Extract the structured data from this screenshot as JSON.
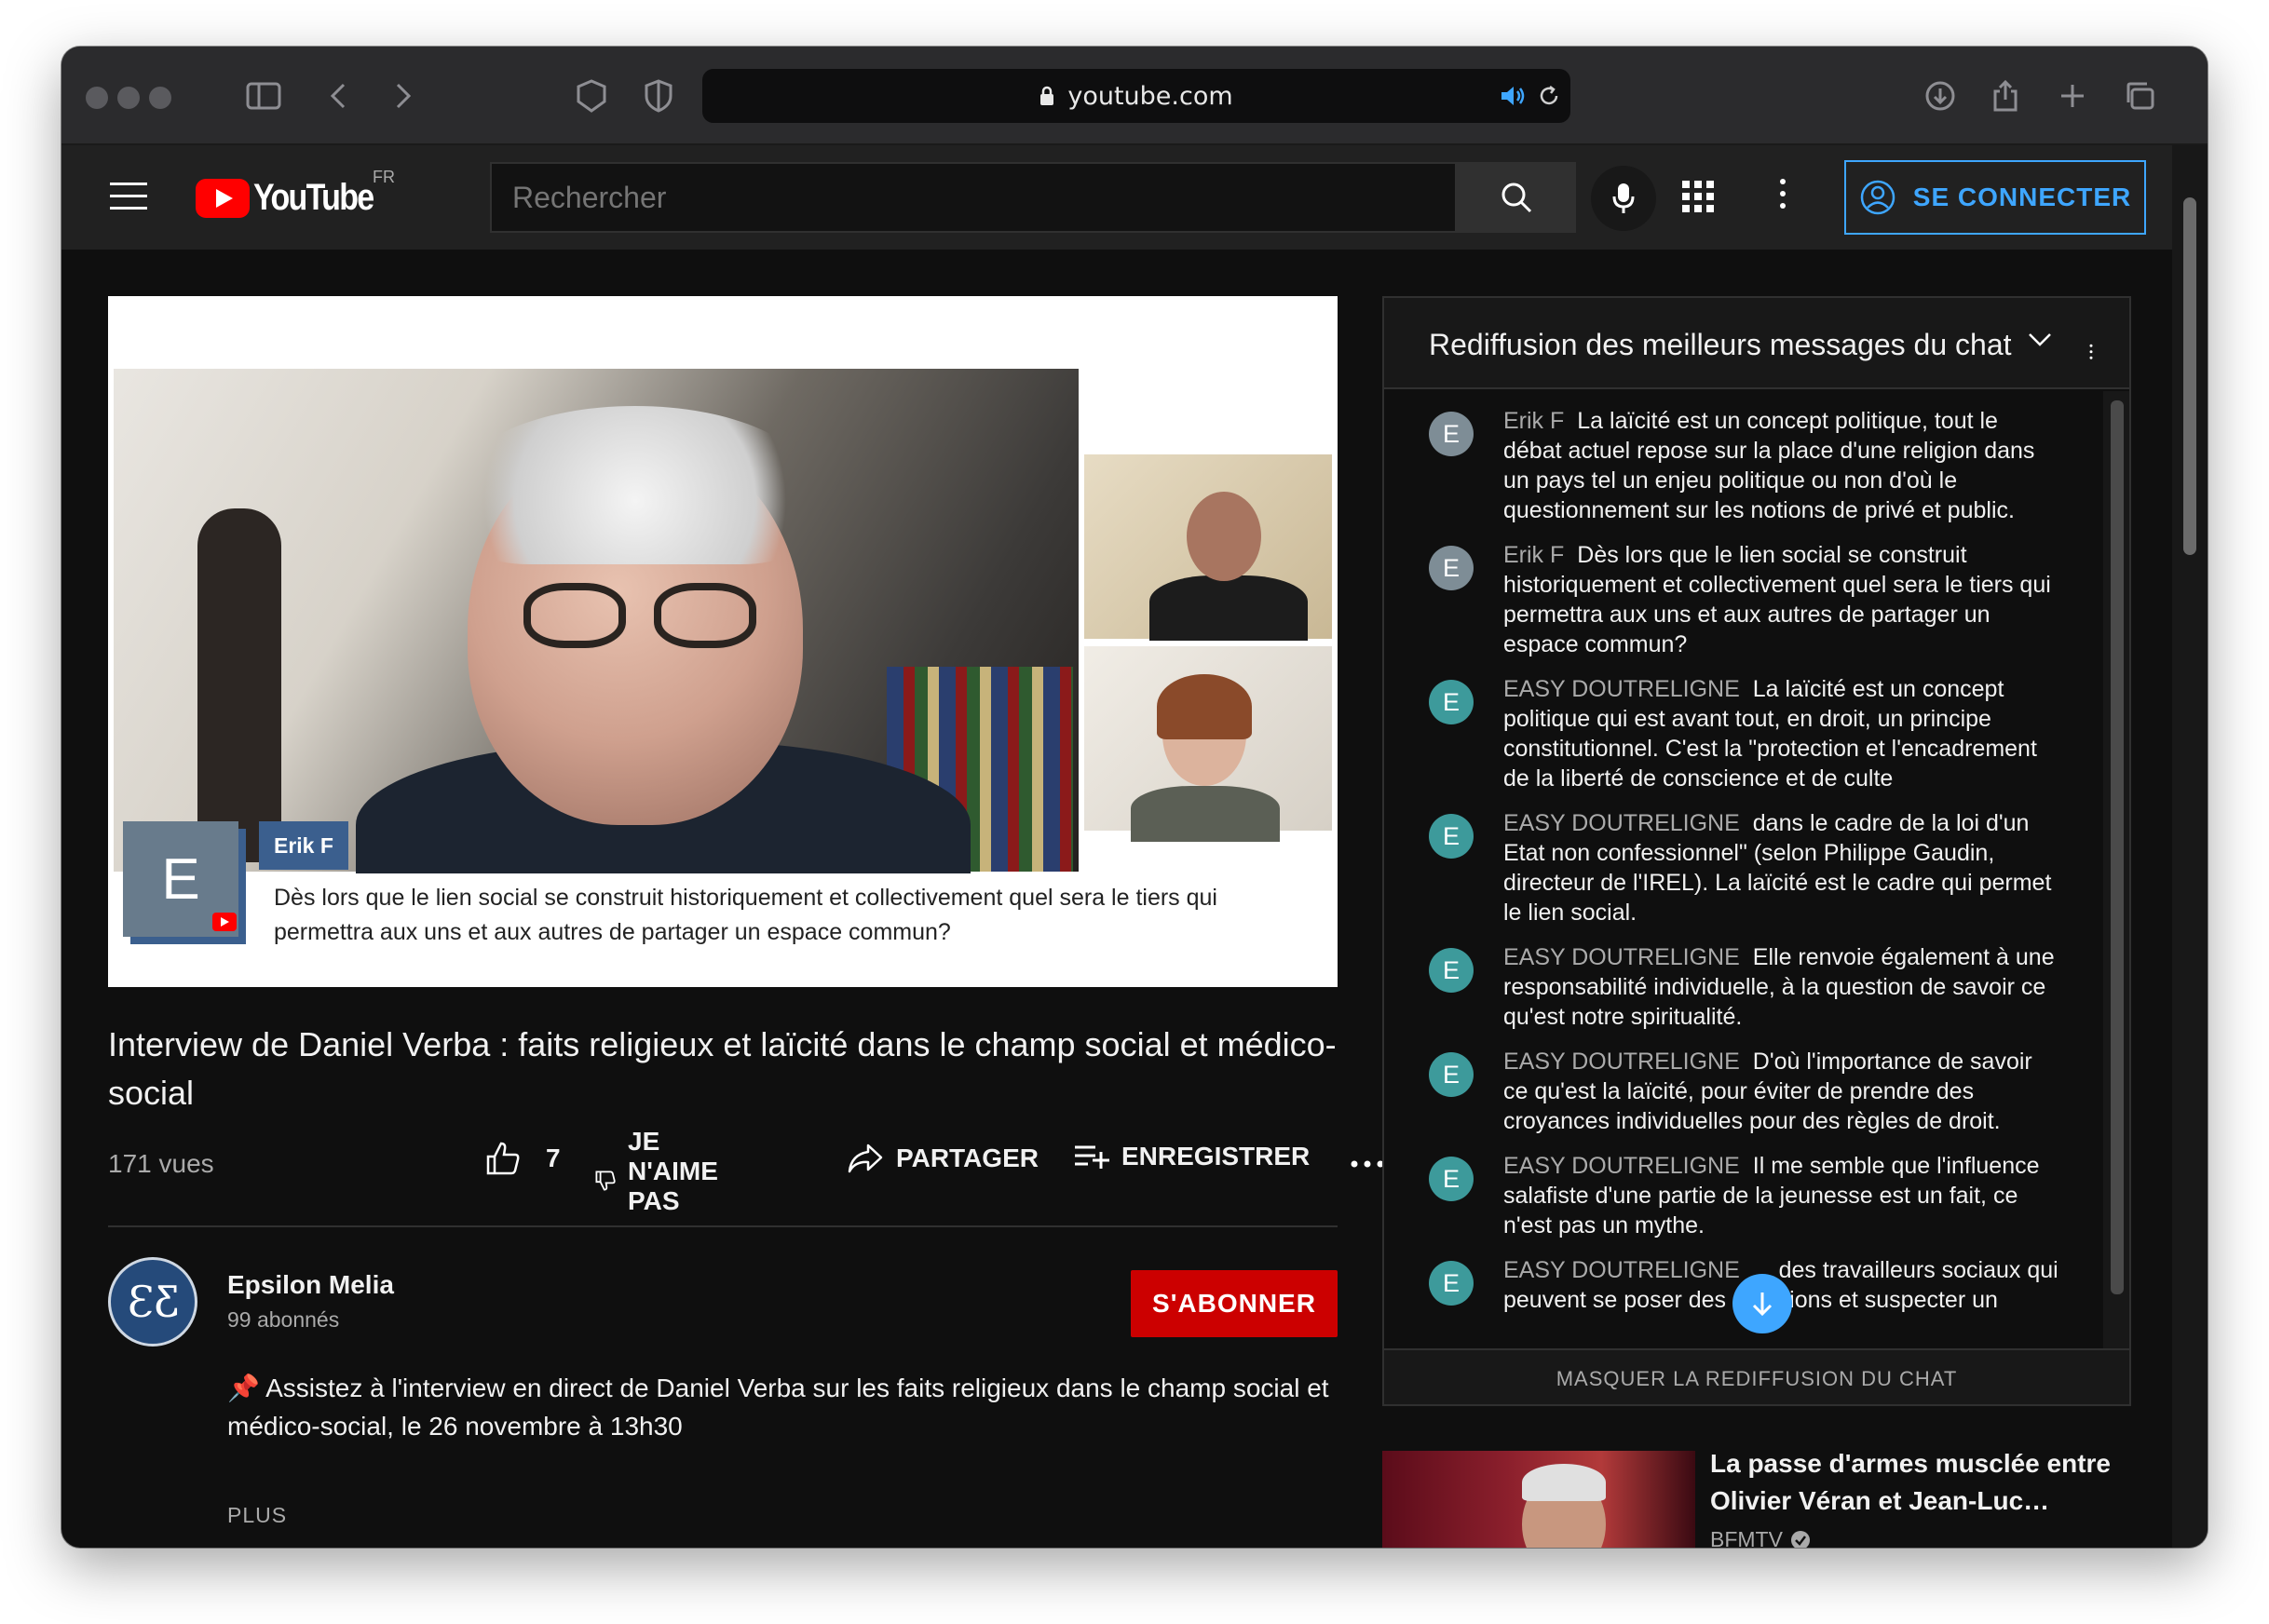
{
  "browser": {
    "url": "youtube.com"
  },
  "header": {
    "logo_text": "YouTube",
    "region": "FR",
    "search_placeholder": "Rechercher",
    "signin_label": "SE CONNECTER"
  },
  "video": {
    "overlay_name": "Erik F",
    "overlay_avatar_letter": "E",
    "overlay_text": "Dès lors que le lien social se construit historiquement et collectivement quel sera le tiers qui permettra aux uns et aux autres de partager un espace commun?"
  },
  "meta": {
    "title": "Interview de Daniel Verba : faits religieux et laïcité dans le champ social et médico-social",
    "views": "171 vues",
    "likes": "7",
    "dislike_label": "JE N'AIME PAS",
    "share_label": "PARTAGER",
    "save_label": "ENREGISTRER"
  },
  "channel": {
    "name": "Epsilon Melia",
    "subscribers": "99 abonnés",
    "subscribe_label": "S'ABONNER",
    "avatar_text": "ƐƸ"
  },
  "description": {
    "pin": "📌",
    "text": "Assistez à l'interview en direct de Daniel Verba sur les faits religieux dans le champ social et médico-social, le 26 novembre à 13h30",
    "more_label": "PLUS"
  },
  "chat": {
    "title": "Rediffusion des meilleurs messages du chat",
    "hide_label": "MASQUER LA REDIFFUSION DU CHAT",
    "messages": [
      {
        "avatar": "E",
        "color": "#7e8d96",
        "author": "Erik F",
        "text": "La laïcité est un concept politique, tout le débat actuel repose sur la place d'une religion dans un pays tel un enjeu politique ou non d'où le questionnement sur les notions de privé et public."
      },
      {
        "avatar": "E",
        "color": "#7e8d96",
        "author": "Erik F",
        "text": "Dès lors que le lien social se construit historiquement et collectivement quel sera le tiers qui permettra aux uns et aux autres de partager un espace commun?"
      },
      {
        "avatar": "E",
        "color": "#3d9a9b",
        "author": "EASY DOUTRELIGNE",
        "text": "La laïcité est un concept politique qui est avant tout, en droit, un principe constitutionnel. C'est la \"protection et l'encadrement de la liberté de conscience et de culte"
      },
      {
        "avatar": "E",
        "color": "#3d9a9b",
        "author": "EASY DOUTRELIGNE",
        "text": "dans le cadre de la loi d'un Etat non confessionnel\" (selon Philippe Gaudin, directeur de l'IREL). La laïcité est le cadre qui permet le lien social."
      },
      {
        "avatar": "E",
        "color": "#3d9a9b",
        "author": "EASY DOUTRELIGNE",
        "text": "Elle renvoie également à une responsabilité individuelle, à la question de savoir ce qu'est notre spiritualité."
      },
      {
        "avatar": "E",
        "color": "#3d9a9b",
        "author": "EASY DOUTRELIGNE",
        "text": "D'où l'importance de savoir ce qu'est la laïcité, pour éviter de prendre des croyances individuelles pour des règles de droit."
      },
      {
        "avatar": "E",
        "color": "#3d9a9b",
        "author": "EASY DOUTRELIGNE",
        "text": "Il me semble que l'influence salafiste d'une partie de la jeunesse est un fait, ce n'est pas un mythe."
      },
      {
        "avatar": "E",
        "color": "#3d9a9b",
        "author": "EASY DOUTRELIGNE",
        "text": "... des travailleurs sociaux qui peuvent se poser des questions et suspecter un"
      }
    ]
  },
  "recommendation": {
    "title": "La passe d'armes musclée entre Olivier Véran et Jean-Luc…",
    "channel": "BFMTV"
  }
}
